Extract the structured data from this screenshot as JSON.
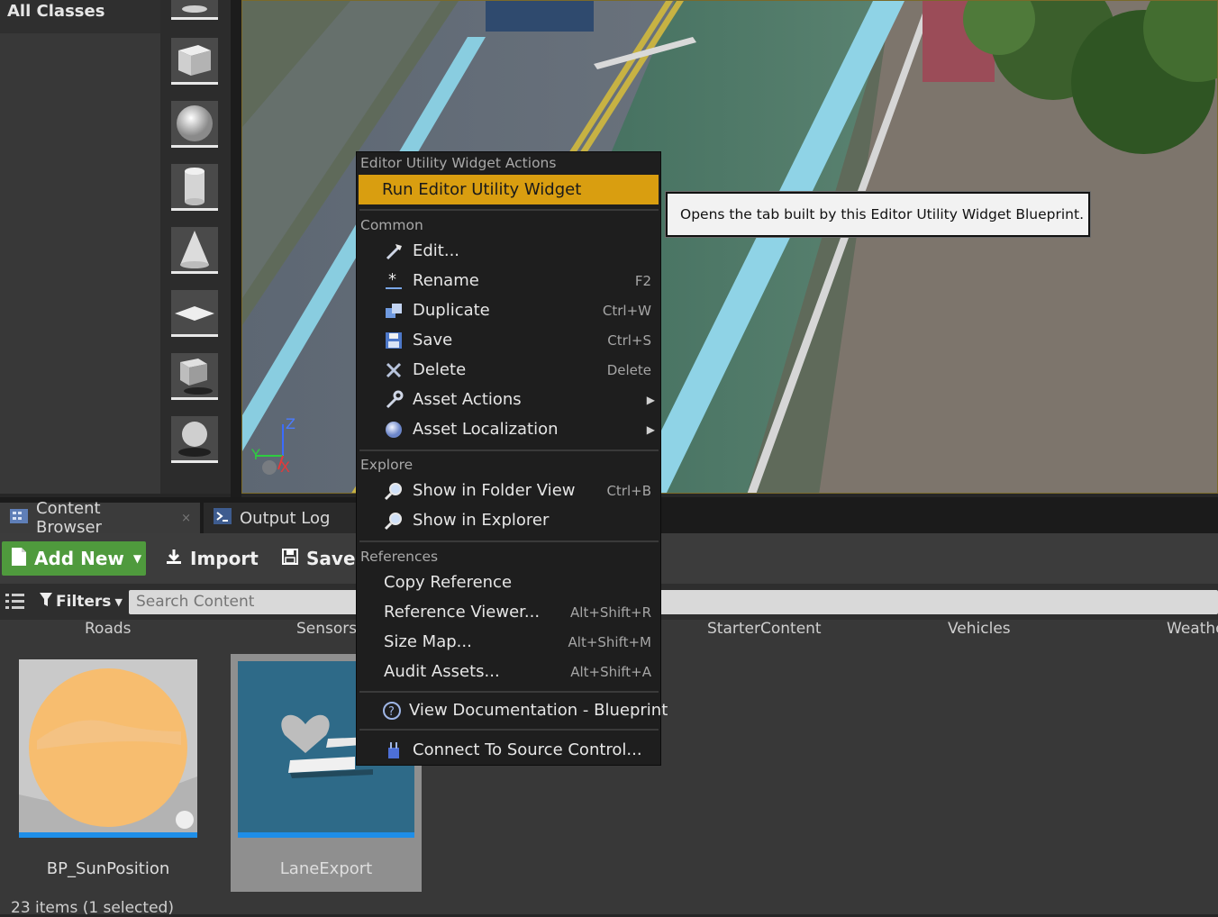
{
  "classes_panel": {
    "title": "All Classes"
  },
  "shapes": [
    "cone-icon",
    "cube-icon",
    "sphere-icon",
    "cylinder-icon",
    "cone-icon",
    "plane-icon",
    "box-trigger-icon",
    "sphere-trigger-icon"
  ],
  "viewport": {
    "axis_labels": {
      "z": "Z",
      "y": "Y",
      "x": "X"
    }
  },
  "tabs": [
    {
      "label": "Content Browser",
      "close": "×"
    },
    {
      "label": "Output Log"
    }
  ],
  "toolbar": {
    "add_new_label": "Add New",
    "import_label": "Import",
    "save_label": "Save"
  },
  "filters": {
    "label": "Filters",
    "search_placeholder": "Search Content"
  },
  "folders": [
    "Roads",
    "Sensors",
    "StarterContent",
    "Vehicles",
    "Weathe"
  ],
  "assets": [
    {
      "name": "BP_SunPosition",
      "selected": false
    },
    {
      "name": "LaneExport",
      "selected": true
    }
  ],
  "status": "23 items (1 selected)",
  "context_menu": {
    "sections": {
      "widget_actions": "Editor Utility Widget Actions",
      "common": "Common",
      "explore": "Explore",
      "references": "References"
    },
    "run_item": "Run Editor Utility Widget",
    "common_items": [
      {
        "label": "Edit...",
        "shortcut": "",
        "icon": "edit-icon"
      },
      {
        "label": "Rename",
        "shortcut": "F2",
        "icon": "rename-icon"
      },
      {
        "label": "Duplicate",
        "shortcut": "Ctrl+W",
        "icon": "duplicate-icon"
      },
      {
        "label": "Save",
        "shortcut": "Ctrl+S",
        "icon": "save-icon"
      },
      {
        "label": "Delete",
        "shortcut": "Delete",
        "icon": "delete-icon"
      },
      {
        "label": "Asset Actions",
        "shortcut": "",
        "icon": "wrench-icon",
        "submenu": true
      },
      {
        "label": "Asset Localization",
        "shortcut": "",
        "icon": "globe-icon",
        "submenu": true
      }
    ],
    "explore_items": [
      {
        "label": "Show in Folder View",
        "shortcut": "Ctrl+B",
        "icon": "magnifier-icon"
      },
      {
        "label": "Show in Explorer",
        "shortcut": "",
        "icon": "magnifier-icon"
      }
    ],
    "reference_items": [
      {
        "label": "Copy Reference",
        "shortcut": ""
      },
      {
        "label": "Reference Viewer...",
        "shortcut": "Alt+Shift+R"
      },
      {
        "label": "Size Map...",
        "shortcut": "Alt+Shift+M"
      },
      {
        "label": "Audit Assets...",
        "shortcut": "Alt+Shift+A"
      }
    ],
    "doc_item": "View Documentation - Blueprint",
    "source_control_item": "Connect To Source Control..."
  },
  "tooltip": "Opens the tab built by this Editor Utility Widget Blueprint.",
  "colors": {
    "menu_highlight": "#d99e10",
    "add_new_green": "#4f9a3d",
    "selection_blue": "#1e8ee8"
  }
}
